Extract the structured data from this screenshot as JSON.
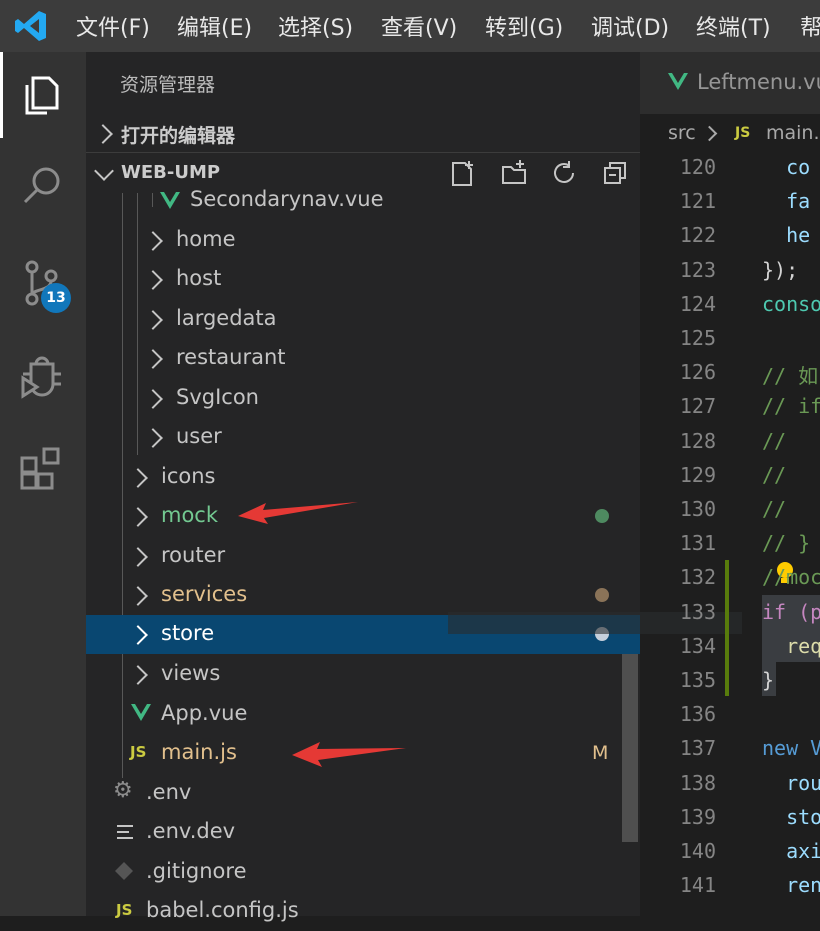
{
  "menu": [
    "文件(F)",
    "编辑(E)",
    "选择(S)",
    "查看(V)",
    "转到(G)",
    "调试(D)",
    "终端(T)",
    "帮"
  ],
  "activity": {
    "scm_badge": "13"
  },
  "sidebar": {
    "header": "资源管理器",
    "open_editors": "打开的编辑器",
    "project": "WEB-UMP"
  },
  "tree": [
    {
      "label": "Secondarynav.vue",
      "kind": "vue",
      "color": "#c5c5c5"
    },
    {
      "label": "home",
      "kind": "folder",
      "color": "#c5c5c5"
    },
    {
      "label": "host",
      "kind": "folder",
      "color": "#c5c5c5"
    },
    {
      "label": "largedata",
      "kind": "folder",
      "color": "#c5c5c5"
    },
    {
      "label": "restaurant",
      "kind": "folder",
      "color": "#c5c5c5"
    },
    {
      "label": "SvgIcon",
      "kind": "folder",
      "color": "#c5c5c5"
    },
    {
      "label": "user",
      "kind": "folder",
      "color": "#c5c5c5"
    },
    {
      "label": "icons",
      "kind": "folder",
      "color": "#c5c5c5"
    },
    {
      "label": "mock",
      "kind": "folder",
      "color": "#73c991"
    },
    {
      "label": "router",
      "kind": "folder",
      "color": "#c5c5c5"
    },
    {
      "label": "services",
      "kind": "folder",
      "color": "#e2c08d"
    },
    {
      "label": "store",
      "kind": "folder",
      "color": "#ffffff"
    },
    {
      "label": "views",
      "kind": "folder",
      "color": "#c5c5c5"
    },
    {
      "label": "App.vue",
      "kind": "vue",
      "color": "#c5c5c5"
    },
    {
      "label": "main.js",
      "kind": "js",
      "color": "#e2c08d",
      "badge": "M"
    },
    {
      "label": ".env",
      "kind": "gear",
      "color": "#c5c5c5"
    },
    {
      "label": ".env.dev",
      "kind": "lines",
      "color": "#c5c5c5"
    },
    {
      "label": ".gitignore",
      "kind": "git",
      "color": "#c5c5c5"
    },
    {
      "label": "babel.config.js",
      "kind": "js",
      "color": "#c5c5c5"
    }
  ],
  "editor": {
    "tab_label": "Leftmenu.vu",
    "breadcrumb_root": "src",
    "breadcrumb_file": "main.",
    "line_numbers": [
      "120",
      "121",
      "122",
      "123",
      "124",
      "125",
      "126",
      "127",
      "128",
      "129",
      "130",
      "131",
      "132",
      "133",
      "134",
      "135",
      "136",
      "137",
      "138",
      "139",
      "140",
      "141"
    ],
    "code_lines": [
      {
        "text": "  co",
        "color": "#9cdcfe"
      },
      {
        "text": "  fa",
        "color": "#9cdcfe"
      },
      {
        "text": "  he",
        "color": "#9cdcfe"
      },
      {
        "text": "});",
        "color": "#d4d4d4"
      },
      {
        "text": "conso",
        "color": "#4ec9b0"
      },
      {
        "text": "",
        "color": "#d4d4d4"
      },
      {
        "text": "// 如",
        "color": "#6a9955"
      },
      {
        "text": "// if",
        "color": "#6a9955"
      },
      {
        "text": "//",
        "color": "#6a9955"
      },
      {
        "text": "//",
        "color": "#6a9955"
      },
      {
        "text": "//",
        "color": "#6a9955"
      },
      {
        "text": "// }",
        "color": "#6a9955"
      },
      {
        "text": "//moc",
        "color": "#6a9955"
      },
      {
        "text": "if (p",
        "color": "#c586c0"
      },
      {
        "text": "  req",
        "color": "#dcdcaa"
      },
      {
        "text": "}",
        "color": "#d4d4d4"
      },
      {
        "text": "",
        "color": "#d4d4d4"
      },
      {
        "text": "new V",
        "color": "#569cd6"
      },
      {
        "text": "  rou",
        "color": "#9cdcfe"
      },
      {
        "text": "  sto",
        "color": "#9cdcfe"
      },
      {
        "text": "  axi",
        "color": "#9cdcfe"
      },
      {
        "text": "  ren",
        "color": "#9cdcfe"
      }
    ]
  },
  "colors": {
    "accent_blue": "#094771",
    "annotation_red": "#e53935"
  }
}
